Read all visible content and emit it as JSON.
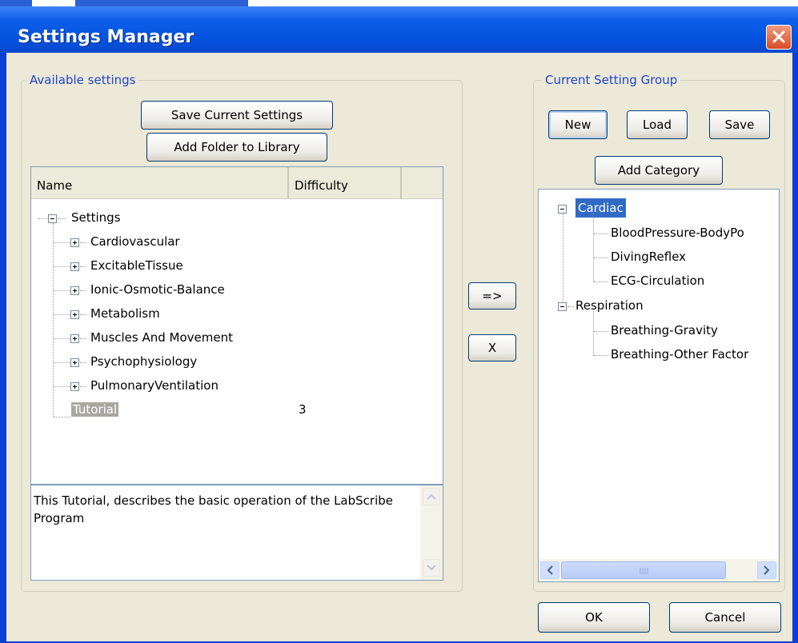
{
  "window": {
    "title": "Settings Manager"
  },
  "available": {
    "group_label": "Available settings",
    "save_current_label": "Save Current Settings",
    "add_folder_label": "Add Folder to Library",
    "columns": [
      "Name",
      "Difficulty"
    ],
    "root": "Settings",
    "folders": [
      "Cardiovascular",
      "ExcitableTissue",
      "Ionic-Osmotic-Balance",
      "Metabolism",
      "Muscles And Movement",
      "Psychophysiology",
      "PulmonaryVentilation"
    ],
    "selected_item": {
      "label": "Tutorial",
      "difficulty": "3"
    },
    "description": "This Tutorial, describes the basic operation of the LabScribe Program"
  },
  "transfer": {
    "add_label": "=>",
    "remove_label": "X"
  },
  "current": {
    "group_label": "Current Setting Group",
    "new_label": "New",
    "load_label": "Load",
    "save_label": "Save",
    "add_category_label": "Add Category",
    "categories": [
      {
        "name": "Cardiac",
        "items": [
          "BloodPressure-BodyPo",
          "DivingReflex",
          "ECG-Circulation"
        ]
      },
      {
        "name": "Respiration",
        "items": [
          "Breathing-Gravity",
          "Breathing-Other Factor"
        ]
      }
    ]
  },
  "footer": {
    "ok_label": "OK",
    "cancel_label": "Cancel"
  },
  "colors": {
    "title_bar": "#0452df",
    "selection": "#316ac5",
    "inactive_selection": "#a9a8a0"
  }
}
